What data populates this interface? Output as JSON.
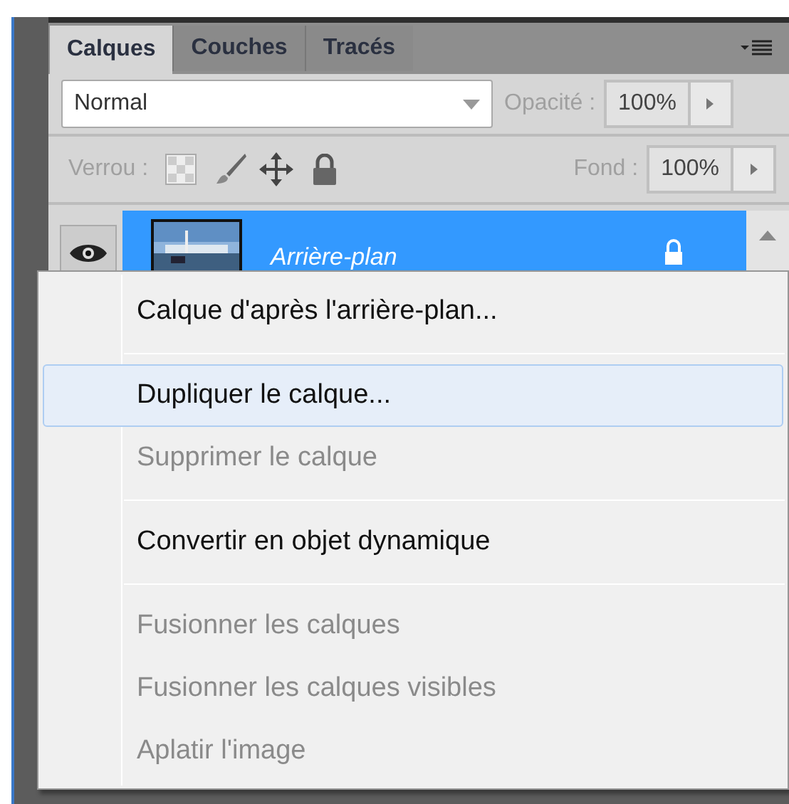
{
  "tabs": [
    {
      "label": "Calques",
      "selected": true
    },
    {
      "label": "Couches",
      "selected": false
    },
    {
      "label": "Tracés",
      "selected": false
    }
  ],
  "blend": {
    "value": "Normal",
    "opacity_label": "Opacité :",
    "opacity": "100%"
  },
  "lock": {
    "label": "Verrou :",
    "fill_label": "Fond :",
    "fill": "100%"
  },
  "layers": [
    {
      "name": "Arrière-plan",
      "visible": true,
      "locked": true,
      "selected": true
    }
  ],
  "menu": {
    "groups": [
      [
        {
          "label": "Calque d'après l'arrière-plan...",
          "disabled": false,
          "selected": false
        }
      ],
      [
        {
          "label": "Dupliquer le calque...",
          "disabled": false,
          "selected": true
        },
        {
          "label": "Supprimer le calque",
          "disabled": true,
          "selected": false
        }
      ],
      [
        {
          "label": "Convertir en objet dynamique",
          "disabled": false,
          "selected": false
        }
      ],
      [
        {
          "label": "Fusionner les calques",
          "disabled": true,
          "selected": false
        },
        {
          "label": "Fusionner les calques visibles",
          "disabled": true,
          "selected": false
        },
        {
          "label": "Aplatir l'image",
          "disabled": true,
          "selected": false
        }
      ]
    ]
  }
}
